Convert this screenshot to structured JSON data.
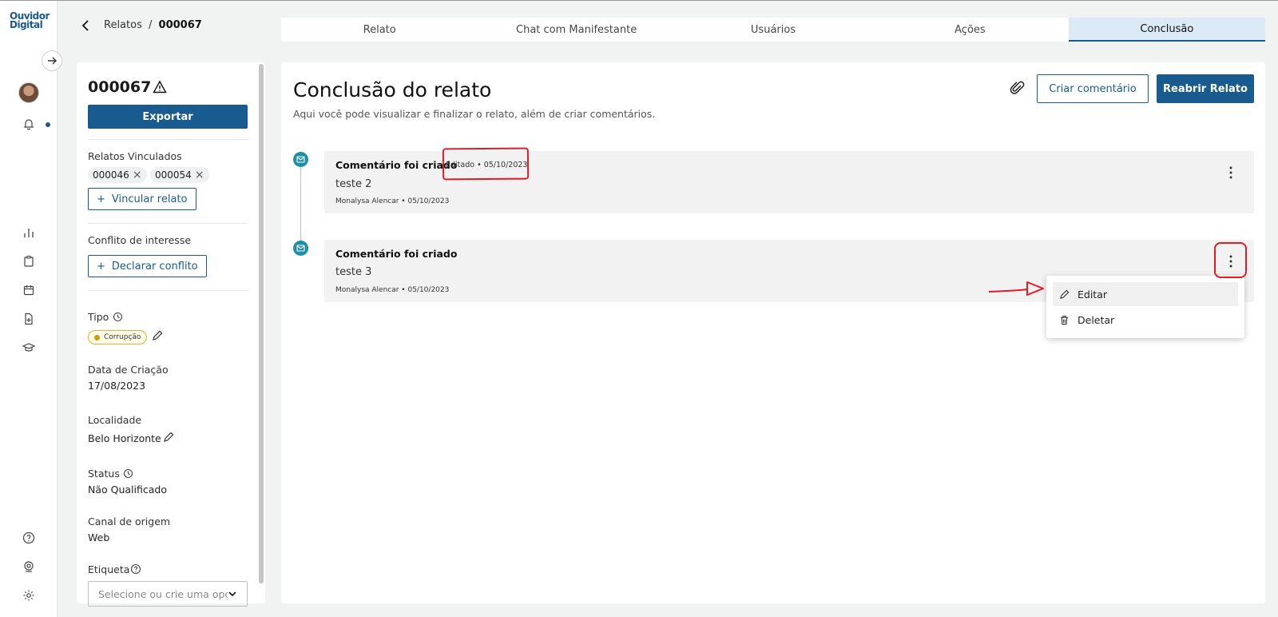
{
  "app": {
    "logo_line1": "Ouvidor",
    "logo_line2": "Digital"
  },
  "breadcrumb": {
    "parent": "Relatos",
    "separator": "/",
    "current": "000067"
  },
  "tabs": [
    {
      "label": "Relato"
    },
    {
      "label": "Chat com Manifestante"
    },
    {
      "label": "Usuários"
    },
    {
      "label": "Ações"
    },
    {
      "label": "Conclusão",
      "active": true
    }
  ],
  "sidebar_panel": {
    "id": "000067",
    "export_label": "Exportar",
    "linked_label": "Relatos Vinculados",
    "linked_items": [
      "000046",
      "000054"
    ],
    "link_button": "Vincular relato",
    "conflict_label": "Conflito de interesse",
    "conflict_button": "Declarar conflito",
    "tipo_label": "Tipo",
    "tipo_value": "Corrupção",
    "created_label": "Data de Criação",
    "created_value": "17/08/2023",
    "locality_label": "Localidade",
    "locality_value": "Belo Horizonte",
    "status_label": "Status",
    "status_value": "Não Qualificado",
    "channel_label": "Canal de origem",
    "channel_value": "Web",
    "tag_label": "Etiqueta",
    "tag_placeholder": "Selecione ou crie uma opção"
  },
  "main": {
    "title": "Conclusão do relato",
    "subtitle": "Aqui você pode visualizar e finalizar o relato, além de criar comentários.",
    "create_comment": "Criar comentário",
    "reopen": "Reabrir Relato",
    "comments": [
      {
        "title": "Comentário foi criado",
        "edited": "Editado • 05/10/2023",
        "text": "teste 2",
        "meta": "Monalysa Alencar • 05/10/2023"
      },
      {
        "title": "Comentário foi criado",
        "text": "teste 3",
        "meta": "Monalysa Alencar • 05/10/2023"
      }
    ]
  },
  "menu": {
    "edit": "Editar",
    "delete": "Deletar"
  },
  "colors": {
    "primary": "#1a5b8f",
    "timeline": "#1f8fa6",
    "annotation": "#e31b23"
  }
}
